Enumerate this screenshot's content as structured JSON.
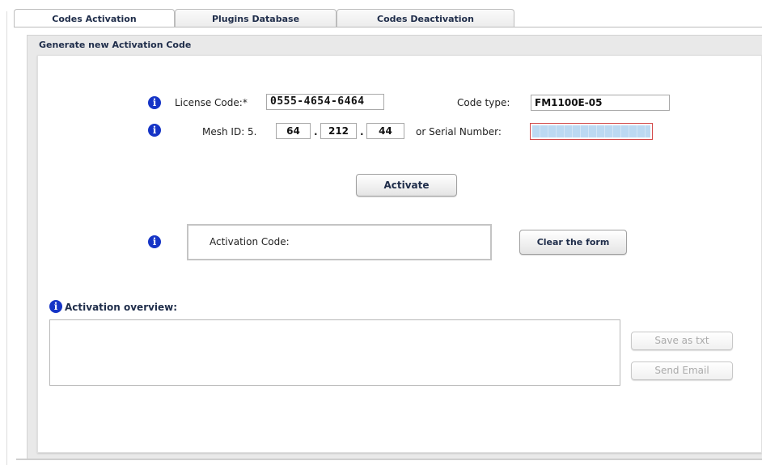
{
  "tabs": [
    {
      "label": "Codes Activation",
      "active": true
    },
    {
      "label": "Plugins Database",
      "active": false
    },
    {
      "label": "Codes Deactivation",
      "active": false
    }
  ],
  "panel": {
    "title": "Generate new Activation Code"
  },
  "form": {
    "license_label": "License Code:*",
    "license_value": "0555-4654-6464",
    "code_type_label": "Code type:",
    "code_type_value": "FM1100E-05",
    "mesh_label": "Mesh ID: 5.",
    "mesh_parts": [
      "64",
      "212",
      "44"
    ],
    "mesh_sep": ".",
    "serial_label": "or Serial Number:",
    "serial_value": ""
  },
  "buttons": {
    "activate": "Activate",
    "clear": "Clear the form",
    "save_txt": "Save as txt",
    "send_email": "Send Email"
  },
  "activation_code_label": "Activation Code:",
  "overview": {
    "heading": "Activation overview:",
    "text": ""
  },
  "icons": {
    "info": "info-icon"
  },
  "colors": {
    "info_blue": "#1534c6",
    "error_border": "#d34a4a",
    "heading_text": "#1f2d4a"
  }
}
